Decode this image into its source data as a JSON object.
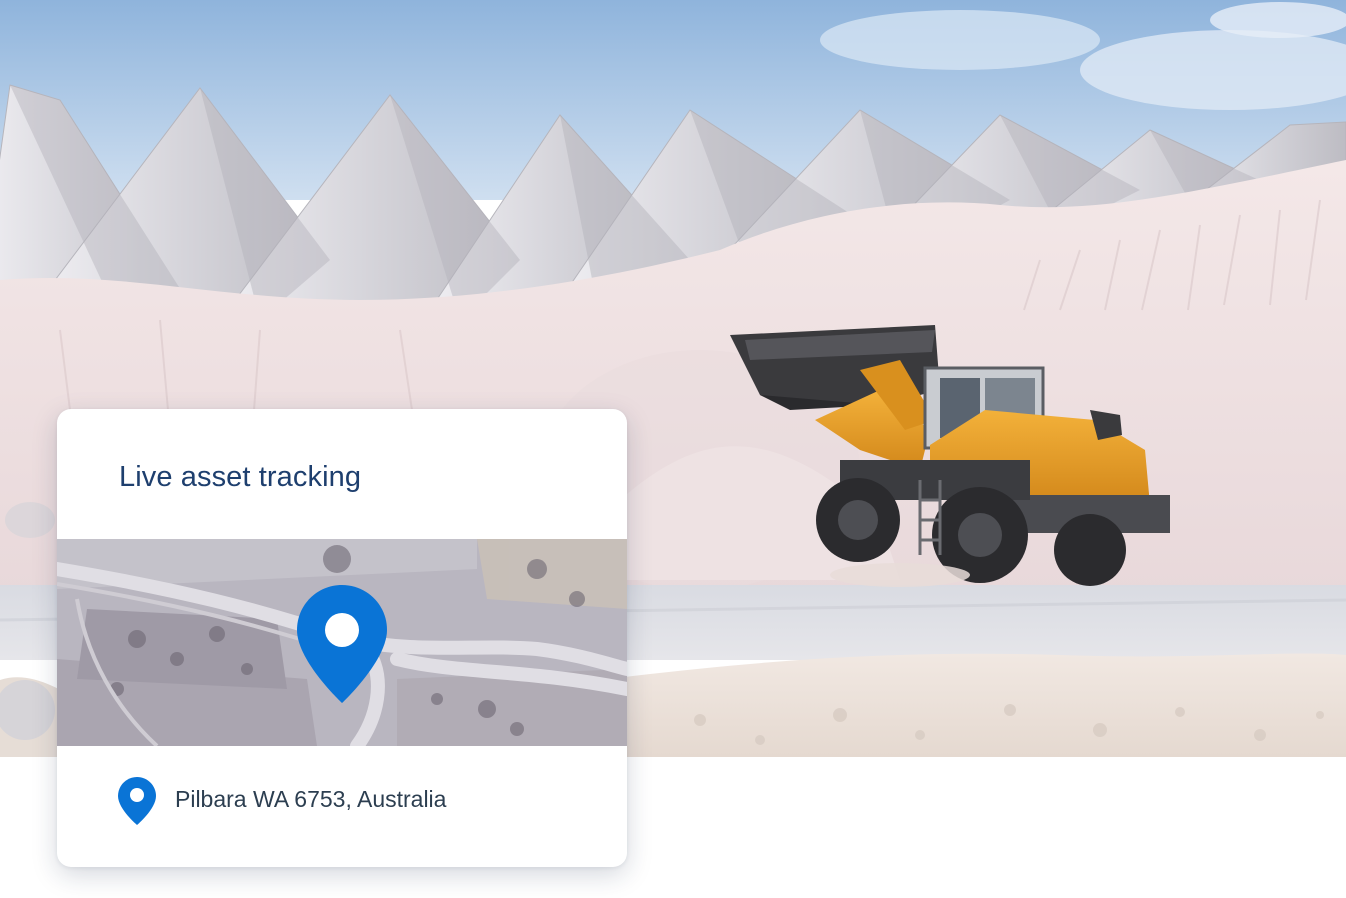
{
  "card": {
    "title": "Live asset tracking",
    "location_text": "Pilbara WA 6753, Australia",
    "map_pin_icon": "map-pin-icon",
    "location_pin_icon": "map-pin-icon"
  },
  "photo": {
    "subject": "wheel-loader-icon"
  },
  "colors": {
    "title": "#1e3f6e",
    "pin": "#0a74d6",
    "loader_body": "#e69a1c",
    "sky": "#aec8e6"
  }
}
